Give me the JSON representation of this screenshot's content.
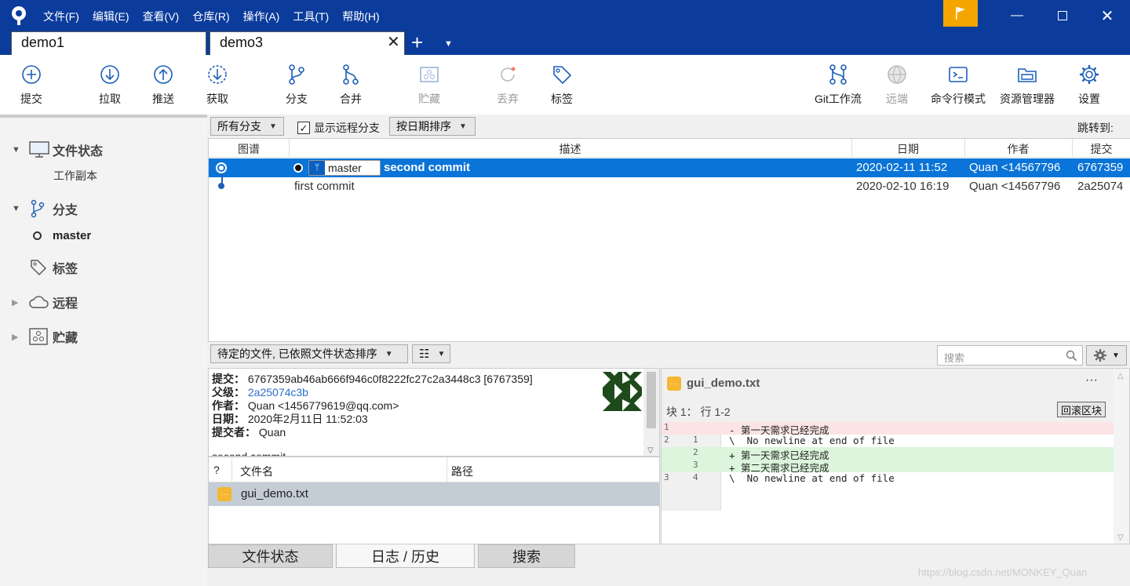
{
  "menu": [
    "文件(F)",
    "编辑(E)",
    "查看(V)",
    "仓库(R)",
    "操作(A)",
    "工具(T)",
    "帮助(H)"
  ],
  "tabs": [
    {
      "label": "demo1"
    },
    {
      "label": "demo3"
    }
  ],
  "toolbar": {
    "commit": "提交",
    "pull": "拉取",
    "push": "推送",
    "fetch": "获取",
    "branch": "分支",
    "merge": "合并",
    "stash": "贮藏",
    "discard": "丢弃",
    "tag": "标签",
    "gitflow": "Git工作流",
    "remote": "远端",
    "terminal": "命令行模式",
    "explorer": "资源管理器",
    "settings": "设置"
  },
  "sidebar": {
    "file_status": "文件状态",
    "working_copy": "工作副本",
    "branches": "分支",
    "current_branch": "master",
    "tags": "标签",
    "remotes": "远程",
    "stashes": "贮藏"
  },
  "filter": {
    "branches": "所有分支",
    "show_remote": "显示远程分支",
    "sort": "按日期排序",
    "jump_to": "跳转到:"
  },
  "columns": {
    "graph": "图谱",
    "description": "描述",
    "date": "日期",
    "author": "作者",
    "commit": "提交"
  },
  "commits": [
    {
      "branch_label": "master",
      "message": "second commit",
      "date": "2020-02-11 11:52",
      "author": "Quan <14567796",
      "hash": "6767359"
    },
    {
      "message": "first commit",
      "date": "2020-02-10 16:19",
      "author": "Quan <14567796",
      "hash": "2a25074"
    }
  ],
  "lower": {
    "pending_sort": "待定的文件, 已依照文件状态排序",
    "search_placeholder": "搜索"
  },
  "details": {
    "commit_label": "提交：",
    "commit_value": "6767359ab46ab666f946c0f8222fc27c2a3448c3 [6767359]",
    "parent_label": "父级：",
    "parent_value": "2a25074c3b",
    "author_label": "作者：",
    "author_value": "Quan <1456779619@qq.com>",
    "date_label": "日期：",
    "date_value": "2020年2月11日 11:52:03",
    "committer_label": "提交者：",
    "committer_value": "Quan",
    "message": "second commit"
  },
  "files": {
    "col_status": "?",
    "col_name": "文件名",
    "col_path": "路径",
    "rows": [
      {
        "name": "gui_demo.txt"
      }
    ]
  },
  "diff": {
    "file": "gui_demo.txt",
    "hunk": "块 1： 行 1-2",
    "revert": "回滚区块",
    "lines": [
      {
        "old": "1",
        "new": "",
        "text": "- 第一天需求已经完成",
        "kind": "del"
      },
      {
        "old": "2",
        "new": "1",
        "text": "\\  No newline at end of file",
        "kind": "ctx"
      },
      {
        "old": "",
        "new": "2",
        "text": "+ 第一天需求已经完成",
        "kind": "add"
      },
      {
        "old": "",
        "new": "3",
        "text": "+ 第二天需求已经完成",
        "kind": "add"
      },
      {
        "old": "3",
        "new": "4",
        "text": "\\  No newline at end of file",
        "kind": "ctx"
      }
    ]
  },
  "bottom_tabs": {
    "file_status": "文件状态",
    "log": "日志 / 历史",
    "search": "搜索"
  },
  "watermark": "https://blog.csdn.net/MONKEY_Quan",
  "colors": {
    "titlebar": "#0b3c9c",
    "selection": "#0a74d8",
    "flag": "#f5a500",
    "file_icon": "#f6b730"
  }
}
